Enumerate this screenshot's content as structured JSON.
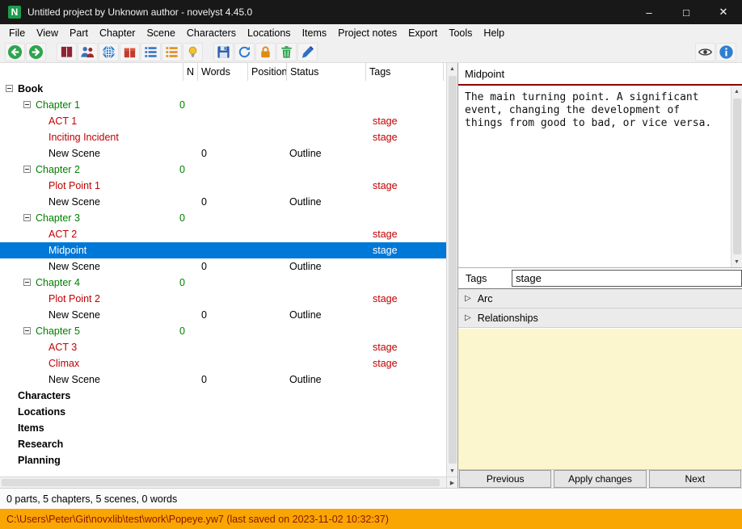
{
  "window": {
    "title": "Untitled project by Unknown author - novelyst 4.45.0",
    "logo_letter": "N"
  },
  "glyphs": {
    "minimize": "–",
    "maximize": "□",
    "close": "✕",
    "scroll_up": "▲",
    "scroll_down": "▼",
    "scroll_right": "▶",
    "section_collapsed": "▷"
  },
  "menubar": {
    "items": [
      "File",
      "View",
      "Part",
      "Chapter",
      "Scene",
      "Characters",
      "Locations",
      "Items",
      "Project notes",
      "Export",
      "Tools",
      "Help"
    ]
  },
  "toolbar": {
    "left_icons": [
      "go-back-icon",
      "go-forward-icon",
      "book-icon",
      "characters-icon",
      "locations-icon",
      "items-icon",
      "scene-list-icon",
      "plot-list-icon",
      "project-notes-icon",
      "save-icon",
      "refresh-icon",
      "lock-icon",
      "trash-icon",
      "edit-icon"
    ],
    "right_icons": [
      "toggle-properties-icon",
      "info-icon"
    ]
  },
  "tree": {
    "columns": {
      "n": "N",
      "words": "Words",
      "position": "Position",
      "status": "Status",
      "tags": "Tags"
    },
    "rows": [
      {
        "label": "Book",
        "type": "root",
        "level": 0,
        "expander": true
      },
      {
        "label": "Chapter 1",
        "type": "chapter",
        "level": 1,
        "expander": true,
        "words": "0"
      },
      {
        "label": "ACT 1",
        "type": "stage",
        "level": 2,
        "tags": "stage"
      },
      {
        "label": "Inciting Incident",
        "type": "stage",
        "level": 2,
        "tags": "stage"
      },
      {
        "label": "New Scene",
        "type": "scene",
        "level": 2,
        "words": "0",
        "status": "Outline"
      },
      {
        "label": "Chapter 2",
        "type": "chapter",
        "level": 1,
        "expander": true,
        "words": "0"
      },
      {
        "label": "Plot Point 1",
        "type": "stage",
        "level": 2,
        "tags": "stage"
      },
      {
        "label": "New Scene",
        "type": "scene",
        "level": 2,
        "words": "0",
        "status": "Outline"
      },
      {
        "label": "Chapter 3",
        "type": "chapter",
        "level": 1,
        "expander": true,
        "words": "0"
      },
      {
        "label": "ACT 2",
        "type": "stage",
        "level": 2,
        "tags": "stage"
      },
      {
        "label": "Midpoint",
        "type": "stage",
        "level": 2,
        "tags": "stage",
        "selected": true
      },
      {
        "label": "New Scene",
        "type": "scene",
        "level": 2,
        "words": "0",
        "status": "Outline"
      },
      {
        "label": "Chapter 4",
        "type": "chapter",
        "level": 1,
        "expander": true,
        "words": "0"
      },
      {
        "label": "Plot Point 2",
        "type": "stage",
        "level": 2,
        "tags": "stage"
      },
      {
        "label": "New Scene",
        "type": "scene",
        "level": 2,
        "words": "0",
        "status": "Outline"
      },
      {
        "label": "Chapter 5",
        "type": "chapter",
        "level": 1,
        "expander": true,
        "words": "0"
      },
      {
        "label": "ACT 3",
        "type": "stage",
        "level": 2,
        "tags": "stage"
      },
      {
        "label": "Climax",
        "type": "stage",
        "level": 2,
        "tags": "stage"
      },
      {
        "label": "New Scene",
        "type": "scene",
        "level": 2,
        "words": "0",
        "status": "Outline"
      },
      {
        "label": "Characters",
        "type": "category",
        "level": 0
      },
      {
        "label": "Locations",
        "type": "category",
        "level": 0
      },
      {
        "label": "Items",
        "type": "category",
        "level": 0
      },
      {
        "label": "Research",
        "type": "category",
        "level": 0
      },
      {
        "label": "Planning",
        "type": "category",
        "level": 0
      }
    ]
  },
  "properties": {
    "title": "Midpoint",
    "description": "The main turning point. A significant event, changing the development of things from good to bad, or vice versa.",
    "tags_label": "Tags",
    "tags_value": "stage",
    "sections": [
      {
        "label": "Arc"
      },
      {
        "label": "Relationships"
      }
    ],
    "notes_value": "",
    "buttons": {
      "previous": "Previous",
      "apply": "Apply changes",
      "next": "Next"
    }
  },
  "footer": {
    "status_text": "0 parts, 5 chapters, 5 scenes, 0 words",
    "path_text": "C:\\Users\\Peter\\Git\\novxlib\\test\\work\\Popeye.yw7 (last saved on 2023-11-02 10:32:37)"
  },
  "colors": {
    "selection": "#0078d7",
    "chapter_green": "#008000",
    "stage_red": "#c00000",
    "path_bar_bg": "#f9a602",
    "path_bar_text": "#8b1500",
    "notes_bg": "#fbf6cd",
    "logo_green": "#1a9e4b",
    "title_underline": "#8b0000"
  }
}
